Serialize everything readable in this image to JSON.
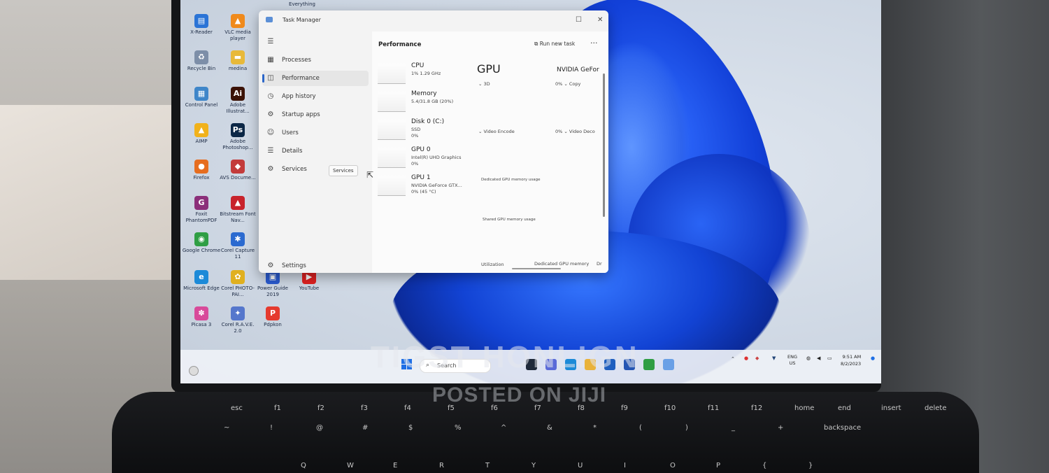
{
  "desktop": {
    "top_partial_label": "Everything",
    "icons": [
      {
        "label": "X-Reader",
        "color": "#2b74d6",
        "glyph": "▤"
      },
      {
        "label": "VLC media player",
        "color": "#f08a1c",
        "glyph": "▲"
      },
      {
        "label": "Recycle Bin",
        "color": "#7d8ea8",
        "glyph": "♻"
      },
      {
        "label": "medina",
        "color": "#e8b93a",
        "glyph": "▬"
      },
      {
        "label": "Control Panel",
        "color": "#3f86c9",
        "glyph": "▦"
      },
      {
        "label": "Adobe Illustrat...",
        "color": "#3b1206",
        "glyph": "Ai"
      },
      {
        "label": "AIMP",
        "color": "#f1b21b",
        "glyph": "▲"
      },
      {
        "label": "Adobe Photoshop...",
        "color": "#0b2746",
        "glyph": "Ps"
      },
      {
        "label": "Firefox",
        "color": "#e66d1f",
        "glyph": "●"
      },
      {
        "label": "AVS Docume...",
        "color": "#c33b3b",
        "glyph": "◆"
      },
      {
        "label": "Foxit PhantomPDF",
        "color": "#8b2f7a",
        "glyph": "G"
      },
      {
        "label": "Bitstream Font Nav...",
        "color": "#c8232c",
        "glyph": "▲"
      },
      {
        "label": "Google Chrome",
        "color": "#2f9e44",
        "glyph": "◉"
      },
      {
        "label": "Corel Capture 11",
        "color": "#2b6ad0",
        "glyph": "✱"
      },
      {
        "label": "Microsoft Edge",
        "color": "#1c8ad8",
        "glyph": "e"
      },
      {
        "label": "Corel PHOTO-PAI...",
        "color": "#e0b020",
        "glyph": "✿"
      },
      {
        "label": "Power Guide 2019",
        "color": "#2a5bd0",
        "glyph": "▣"
      },
      {
        "label": "YouTube",
        "color": "#e02121",
        "glyph": "▶"
      },
      {
        "label": "Picasa 3",
        "color": "#d84a9a",
        "glyph": "✽"
      },
      {
        "label": "Corel R.A.V.E. 2.0",
        "color": "#5577cc",
        "glyph": "✦"
      },
      {
        "label": "Pdpkon",
        "color": "#e53a2e",
        "glyph": "P"
      }
    ]
  },
  "task_manager": {
    "window_title": "Task Manager",
    "controls": {
      "maximize": "☐",
      "close": "✕"
    },
    "menu_glyph": "☰",
    "nav": [
      {
        "label": "Processes",
        "icon": "▦"
      },
      {
        "label": "Performance",
        "icon": "◫"
      },
      {
        "label": "App history",
        "icon": "◷"
      },
      {
        "label": "Startup apps",
        "icon": "⚙"
      },
      {
        "label": "Users",
        "icon": "☺"
      },
      {
        "label": "Details",
        "icon": "☰"
      },
      {
        "label": "Services",
        "icon": "⚙"
      }
    ],
    "settings_label": "Settings",
    "tooltip": "Services",
    "pane_title": "Performance",
    "run_new_task": "Run new task",
    "more": "···",
    "devices": [
      {
        "name": "CPU",
        "line1": "1% 1.29 GHz",
        "line2": ""
      },
      {
        "name": "Memory",
        "line1": "5.4/31.8 GB (20%)",
        "line2": ""
      },
      {
        "name": "Disk 0 (C:)",
        "line1": "SSD",
        "line2": "0%"
      },
      {
        "name": "GPU 0",
        "line1": "Intel(R) UHD Graphics",
        "line2": "0%"
      },
      {
        "name": "GPU 1",
        "line1": "NVIDIA GeForce GTX...",
        "line2": "0% (45 °C)"
      }
    ],
    "detail": {
      "heading": "GPU",
      "model": "NVIDIA GeFor",
      "engine1": "⌄ 3D",
      "engine2": "0% ⌄ Copy",
      "engine3": "⌄ Video Encode",
      "engine4": "0% ⌄ Video Deco",
      "dedicated": "Dedicated GPU memory usage",
      "shared": "Shared GPU memory usage",
      "utilization": "Utilization",
      "dedicated_mem": "Dedicated GPU memory",
      "overflow": "Dr"
    }
  },
  "taskbar": {
    "search_label": "Search",
    "lang_line1": "ENG",
    "lang_line2": "US",
    "time": "9:51 AM",
    "date": "8/2/2023",
    "apps": [
      {
        "name": "task-view",
        "color": "#1f2a3a"
      },
      {
        "name": "meet",
        "color": "#5a6ad8"
      },
      {
        "name": "edge",
        "color": "#1c8ad8"
      },
      {
        "name": "file-explorer",
        "color": "#e9b23a"
      },
      {
        "name": "mail",
        "color": "#1f5fbf"
      },
      {
        "name": "store",
        "color": "#2455b3"
      },
      {
        "name": "chrome",
        "color": "#2f9e44"
      },
      {
        "name": "task-manager",
        "color": "#6aa0e6"
      }
    ]
  },
  "watermark": {
    "line1": "TIGST HONLIGN",
    "line2": "POSTED ON JIJI"
  },
  "keyboard": {
    "keys_row1": [
      "esc",
      "f1",
      "f2",
      "f3",
      "f4",
      "f5",
      "f6",
      "f7",
      "f8",
      "f9",
      "f10",
      "f11",
      "f12",
      "home",
      "end",
      "insert",
      "delete"
    ],
    "keys_row2": [
      "~",
      "!",
      "@",
      "#",
      "$",
      "%",
      "^",
      "&",
      "*",
      "(",
      ")",
      "_",
      "+",
      "backspace"
    ],
    "keys_row3": [
      "Q",
      "W",
      "E",
      "R",
      "T",
      "Y",
      "U",
      "I",
      "O",
      "P",
      "{",
      "}"
    ]
  }
}
